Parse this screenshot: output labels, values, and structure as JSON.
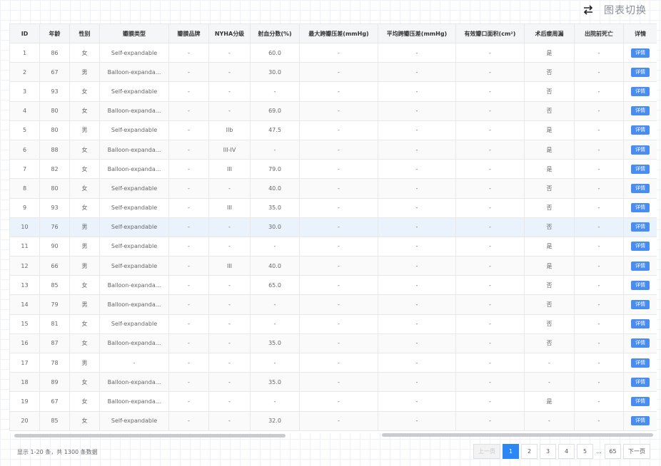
{
  "switch": {
    "label": "图表切换",
    "icon": "swap-arrows-icon"
  },
  "table": {
    "headers": [
      "ID",
      "年龄",
      "性别",
      "瓣膜类型",
      "瓣膜品牌",
      "NYHA分级",
      "射血分数(%)",
      "最大跨瓣压差(mmHg)",
      "平均跨瓣压差(mmHg)",
      "有效瓣口面积(cm²)",
      "术后瘘周漏",
      "出院前死亡",
      "详情"
    ],
    "detail_label": "详情",
    "rows": [
      [
        "1",
        "86",
        "女",
        "Self-expandable",
        "-",
        "-",
        "60.0",
        "-",
        "-",
        "-",
        "是",
        "-"
      ],
      [
        "2",
        "67",
        "男",
        "Balloon-expanda...",
        "-",
        "-",
        "30.0",
        "-",
        "-",
        "-",
        "否",
        "-"
      ],
      [
        "3",
        "93",
        "女",
        "Self-expandable",
        "-",
        "-",
        "-",
        "-",
        "-",
        "-",
        "否",
        "-"
      ],
      [
        "4",
        "80",
        "女",
        "Balloon-expanda...",
        "-",
        "-",
        "69.0",
        "-",
        "-",
        "-",
        "否",
        "-"
      ],
      [
        "5",
        "80",
        "男",
        "Self-expandable",
        "-",
        "IIb",
        "47.5",
        "-",
        "-",
        "-",
        "是",
        "-"
      ],
      [
        "6",
        "88",
        "女",
        "Balloon-expanda...",
        "-",
        "III-IV",
        "-",
        "-",
        "-",
        "-",
        "是",
        "-"
      ],
      [
        "7",
        "82",
        "女",
        "Balloon-expanda...",
        "-",
        "III",
        "79.0",
        "-",
        "-",
        "-",
        "是",
        "-"
      ],
      [
        "8",
        "80",
        "女",
        "Self-expandable",
        "-",
        "-",
        "40.0",
        "-",
        "-",
        "-",
        "否",
        "-"
      ],
      [
        "9",
        "93",
        "女",
        "Self-expandable",
        "-",
        "III",
        "35.0",
        "-",
        "-",
        "-",
        "否",
        "-"
      ],
      [
        "10",
        "76",
        "男",
        "Self-expandable",
        "-",
        "-",
        "30.0",
        "-",
        "-",
        "-",
        "否",
        "-"
      ],
      [
        "11",
        "90",
        "男",
        "Self-expandable",
        "-",
        "-",
        "-",
        "-",
        "-",
        "-",
        "是",
        "-"
      ],
      [
        "12",
        "66",
        "男",
        "Self-expandable",
        "-",
        "III",
        "40.0",
        "-",
        "-",
        "-",
        "是",
        "-"
      ],
      [
        "13",
        "85",
        "女",
        "Balloon-expanda...",
        "-",
        "-",
        "65.0",
        "-",
        "-",
        "-",
        "否",
        "-"
      ],
      [
        "14",
        "79",
        "男",
        "Balloon-expanda...",
        "-",
        "-",
        "-",
        "-",
        "-",
        "-",
        "否",
        "-"
      ],
      [
        "15",
        "81",
        "女",
        "Self-expandable",
        "-",
        "-",
        "-",
        "-",
        "-",
        "-",
        "否",
        "-"
      ],
      [
        "16",
        "87",
        "女",
        "Balloon-expanda...",
        "-",
        "-",
        "35.0",
        "-",
        "-",
        "-",
        "否",
        "-"
      ],
      [
        "17",
        "78",
        "男",
        "-",
        "-",
        "-",
        "-",
        "-",
        "-",
        "-",
        "-",
        "-"
      ],
      [
        "18",
        "89",
        "女",
        "Balloon-expanda...",
        "-",
        "-",
        "35.0",
        "-",
        "-",
        "-",
        "-",
        "-"
      ],
      [
        "19",
        "67",
        "女",
        "Balloon-expanda...",
        "-",
        "-",
        "-",
        "-",
        "-",
        "-",
        "是",
        "-"
      ],
      [
        "20",
        "85",
        "女",
        "Self-expandable",
        "-",
        "-",
        "32.0",
        "-",
        "-",
        "-",
        "-",
        "-"
      ]
    ]
  },
  "footer": {
    "info": "显示 1-20 条，共 1300 条数据"
  },
  "pagination": {
    "prev": "上一页",
    "pages": [
      "1",
      "2",
      "3",
      "4",
      "5"
    ],
    "ellipsis": "...",
    "last": "65",
    "next": "下一页",
    "active": "1"
  }
}
